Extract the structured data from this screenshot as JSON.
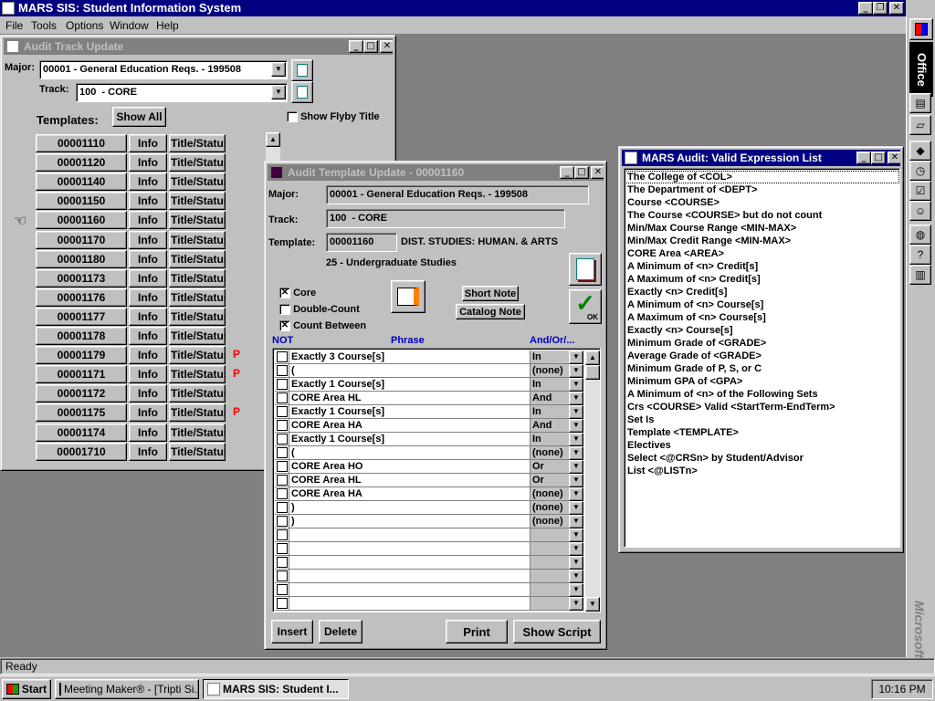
{
  "app": {
    "title": "MARS SIS: Student Information System",
    "menu": [
      "File",
      "Tools",
      "Options",
      "Window",
      "Help"
    ]
  },
  "audit_track": {
    "title": "Audit Track Update",
    "major_label": "Major:",
    "major_value": "00001 - General Education Reqs. - 199508",
    "track_label": "Track:",
    "track_value": "100  - CORE",
    "templates_label": "Templates:",
    "show_all": "Show All",
    "show_flyby": "Show Flyby Title",
    "info_label": "Info",
    "title_status_label": "Title/Status",
    "templates": [
      {
        "code": "00001110",
        "flag": ""
      },
      {
        "code": "00001120",
        "flag": ""
      },
      {
        "code": "00001140",
        "flag": ""
      },
      {
        "code": "00001150",
        "flag": ""
      },
      {
        "code": "00001160",
        "flag": ""
      },
      {
        "code": "00001170",
        "flag": ""
      },
      {
        "code": "00001180",
        "flag": ""
      },
      {
        "code": "00001173",
        "flag": ""
      },
      {
        "code": "00001176",
        "flag": ""
      },
      {
        "code": "00001177",
        "flag": ""
      },
      {
        "code": "00001178",
        "flag": ""
      },
      {
        "code": "00001179",
        "flag": "P"
      },
      {
        "code": "00001171",
        "flag": "P"
      },
      {
        "code": "00001172",
        "flag": ""
      },
      {
        "code": "00001175",
        "flag": "P"
      },
      {
        "code": "00001174",
        "flag": ""
      },
      {
        "code": "00001710",
        "flag": ""
      }
    ]
  },
  "template_update": {
    "title": "Audit Template Update - 00001160",
    "major_label": "Major:",
    "major_value": "00001 - General Education Reqs. - 199508",
    "track_label": "Track:",
    "track_value": "100  - CORE",
    "template_label": "Template:",
    "template_value": "00001160",
    "template_desc": "DIST. STUDIES: HUMAN. & ARTS",
    "level": "25 - Undergraduate Studies",
    "core_label": "Core",
    "double_count_label": "Double-Count",
    "count_between_label": "Count Between",
    "short_note": "Short Note",
    "catalog_note": "Catalog Note",
    "ok_label": "OK",
    "col_not": "NOT",
    "col_phrase": "Phrase",
    "col_andor": "And/Or/...",
    "rows": [
      {
        "phrase": "Exactly 3 Course[s]",
        "andor": "In"
      },
      {
        "phrase": "(",
        "andor": "(none)"
      },
      {
        "phrase": "Exactly 1 Course[s]",
        "andor": "In"
      },
      {
        "phrase": "CORE Area HL",
        "andor": "And"
      },
      {
        "phrase": "Exactly 1 Course[s]",
        "andor": "In"
      },
      {
        "phrase": "CORE Area HA",
        "andor": "And"
      },
      {
        "phrase": "Exactly 1 Course[s]",
        "andor": "In"
      },
      {
        "phrase": "(",
        "andor": "(none)"
      },
      {
        "phrase": "CORE Area HO",
        "andor": "Or"
      },
      {
        "phrase": "CORE Area HL",
        "andor": "Or"
      },
      {
        "phrase": "CORE Area HA",
        "andor": "(none)"
      },
      {
        "phrase": ")",
        "andor": "(none)"
      },
      {
        "phrase": ")",
        "andor": "(none)"
      },
      {
        "phrase": "",
        "andor": ""
      },
      {
        "phrase": "",
        "andor": ""
      },
      {
        "phrase": "",
        "andor": ""
      },
      {
        "phrase": "",
        "andor": ""
      },
      {
        "phrase": "",
        "andor": ""
      },
      {
        "phrase": "",
        "andor": ""
      }
    ],
    "insert": "Insert",
    "delete": "Delete",
    "print": "Print",
    "show_script": "Show Script"
  },
  "expr_list": {
    "title": "MARS Audit: Valid Expression List",
    "items": [
      "The College of <COL>",
      "The Department of <DEPT>",
      "Course <COURSE>",
      "The Course <COURSE> but do not count",
      "Min/Max Course Range <MIN-MAX>",
      "Min/Max Credit Range <MIN-MAX>",
      "CORE Area <AREA>",
      "A Minimum of <n> Credit[s]",
      "A Maximum of <n> Credit[s]",
      "Exactly <n> Credit[s]",
      "A Minimum of <n> Course[s]",
      "A Maximum of <n> Course[s]",
      "Exactly <n> Course[s]",
      "Minimum Grade of <GRADE>",
      "Average Grade of <GRADE>",
      "Minimum Grade of P, S, or C",
      "Minimum GPA of <GPA>",
      "A Minimum of <n> of the Following Sets",
      "Crs <COURSE> Valid <StartTerm-EndTerm>",
      "Set Is",
      "Template <TEMPLATE>",
      "Electives",
      "Select <@CRSn> by Student/Advisor",
      "List <@LISTn>"
    ]
  },
  "office_bar": {
    "label": "Office",
    "brand": "Microsoft"
  },
  "status": {
    "text": "Ready"
  },
  "taskbar": {
    "start": "Start",
    "tasks": [
      "Meeting Maker® - [Tripti Si...",
      "MARS SIS: Student I..."
    ],
    "clock": "10:16 PM"
  }
}
